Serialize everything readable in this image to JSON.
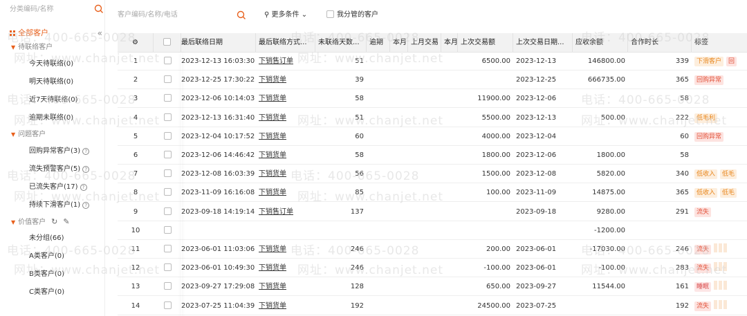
{
  "sidebar": {
    "search_placeholder": "分类编码/名称",
    "all_label": "全部客户",
    "groups": [
      {
        "label": "待联络客户",
        "items": [
          "今天待联络(0)",
          "明天待联络(0)",
          "近7天待联络(0)",
          "逾期未联络(0)"
        ]
      },
      {
        "label": "问题客户",
        "items": [
          "回购异常客户(3)",
          "流失预警客户(5)",
          "已流失客户(17)",
          "持续下滑客户(1)"
        ]
      },
      {
        "label": "价值客户",
        "items": [
          "未分组(66)",
          "A类客户(0)",
          "B类客户(0)",
          "C类客户(0)"
        ]
      }
    ]
  },
  "toolbar": {
    "search_placeholder": "客户编码/名称/电话",
    "more_label": "更多条件",
    "mine_label": "我分管的客户"
  },
  "table": {
    "headers": {
      "last_date": "最后联络日期",
      "last_method": "最后联络方式...",
      "days": "未联络天数...",
      "overdue": "逾期",
      "c_month": "本月",
      "last_month": "上月交易",
      "this_month": "本月",
      "last_amount": "上次交易额",
      "last_tx_date": "上次交易日期...",
      "receivable": "应收余额",
      "duration": "合作时长",
      "tags": "标签"
    },
    "rows": [
      {
        "no": "1",
        "date": "2023-12-13 16:03:30",
        "method": "下销售订单",
        "days": "51",
        "amount": "6500.00",
        "txdate": "2023-12-13",
        "recv": "146800.00",
        "dur": "339",
        "tags": [
          {
            "t": "下滑客户",
            "c": "org"
          },
          {
            "t": "回",
            "c": "red"
          }
        ]
      },
      {
        "no": "2",
        "date": "2023-12-25 17:30:22",
        "method": "下销货单",
        "days": "39",
        "amount": "",
        "txdate": "2023-12-25",
        "recv": "666735.00",
        "dur": "365",
        "tags": [
          {
            "t": "回购异常",
            "c": "red"
          }
        ]
      },
      {
        "no": "3",
        "date": "2023-12-06 10:14:03",
        "method": "下销货单",
        "days": "58",
        "amount": "11900.00",
        "txdate": "2023-12-06",
        "recv": "",
        "dur": "58",
        "tags": []
      },
      {
        "no": "4",
        "date": "2023-12-13 16:31:40",
        "method": "下销货单",
        "days": "51",
        "amount": "5500.00",
        "txdate": "2023-12-13",
        "recv": "500.00",
        "dur": "222",
        "tags": [
          {
            "t": "低毛利",
            "c": "org"
          }
        ]
      },
      {
        "no": "5",
        "date": "2023-12-04 10:17:52",
        "method": "下销货单",
        "days": "60",
        "amount": "4000.00",
        "txdate": "2023-12-04",
        "recv": "",
        "dur": "60",
        "tags": [
          {
            "t": "回购异常",
            "c": "red"
          }
        ]
      },
      {
        "no": "6",
        "date": "2023-12-06 14:46:42",
        "method": "下销货单",
        "days": "58",
        "amount": "1800.00",
        "txdate": "2023-12-06",
        "recv": "1800.00",
        "dur": "58",
        "tags": []
      },
      {
        "no": "7",
        "date": "2023-12-08 16:03:39",
        "method": "下销货单",
        "days": "56",
        "amount": "1500.00",
        "txdate": "2023-12-08",
        "recv": "5820.00",
        "dur": "340",
        "tags": [
          {
            "t": "低收入",
            "c": "org"
          },
          {
            "t": "低毛",
            "c": "org"
          }
        ]
      },
      {
        "no": "8",
        "date": "2023-11-09 16:16:08",
        "method": "下销货单",
        "days": "85",
        "amount": "100.00",
        "txdate": "2023-11-09",
        "recv": "14875.00",
        "dur": "365",
        "tags": [
          {
            "t": "低收入",
            "c": "org"
          },
          {
            "t": "低毛",
            "c": "org"
          }
        ]
      },
      {
        "no": "9",
        "date": "2023-09-18 14:19:14",
        "method": "下销售订单",
        "days": "137",
        "amount": "",
        "txdate": "2023-09-18",
        "recv": "9280.00",
        "dur": "291",
        "tags": [
          {
            "t": "流失",
            "c": "red"
          }
        ]
      },
      {
        "no": "10",
        "date": "",
        "method": "",
        "days": "",
        "amount": "",
        "txdate": "",
        "recv": "-1200.00",
        "dur": "",
        "tags": []
      },
      {
        "no": "11",
        "date": "2023-06-01 11:03:06",
        "method": "下销货单",
        "days": "246",
        "amount": "200.00",
        "txdate": "2023-06-01",
        "recv": "-17030.00",
        "dur": "246",
        "tags": [
          {
            "t": "流失",
            "c": "red"
          }
        ]
      },
      {
        "no": "12",
        "date": "2023-06-01 10:49:30",
        "method": "下销货单",
        "days": "246",
        "amount": "-100.00",
        "txdate": "2023-06-01",
        "recv": "-100.00",
        "dur": "283",
        "tags": [
          {
            "t": "流失",
            "c": "red"
          }
        ]
      },
      {
        "no": "13",
        "date": "2023-09-27 17:29:08",
        "method": "下销货单",
        "days": "128",
        "amount": "650.00",
        "txdate": "2023-09-27",
        "recv": "11544.00",
        "dur": "161",
        "tags": [
          {
            "t": "睡眠",
            "c": "pink"
          }
        ]
      },
      {
        "no": "14",
        "date": "2023-07-25 11:04:39",
        "method": "下销货单",
        "days": "192",
        "amount": "24500.00",
        "txdate": "2023-07-25",
        "recv": "",
        "dur": "192",
        "tags": [
          {
            "t": "流失",
            "c": "red"
          }
        ]
      }
    ]
  },
  "watermark": {
    "phone": "电话：400-665-0028",
    "site": "网址：www.chanjet.net"
  },
  "colors": {
    "accent": "#e8601c",
    "header_bg": "#f2f2f2"
  }
}
